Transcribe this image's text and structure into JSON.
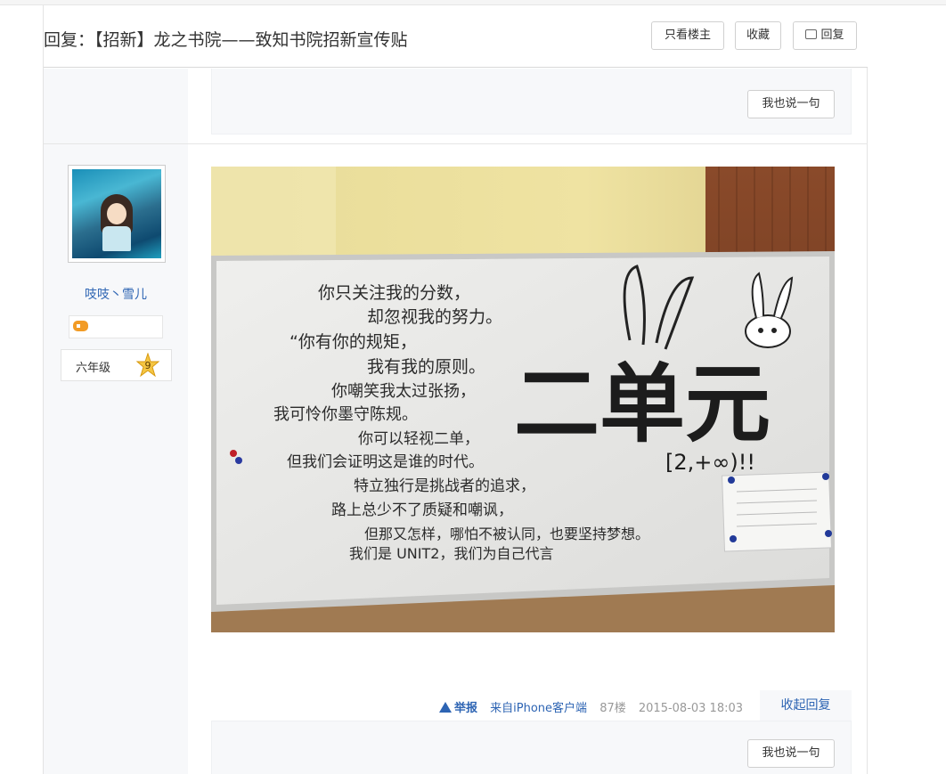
{
  "header": {
    "title": "回复：【招新】龙之书院——致知书院招新宣传贴",
    "only_op_label": "只看楼主",
    "favorite_label": "收藏",
    "reply_label": "回复"
  },
  "comment_box_top": {
    "say_label": "我也说一句"
  },
  "author": {
    "name": "吱吱丶雪儿",
    "level_name": "六年级",
    "level_num": "9",
    "avatar_icon": "anime-avatar-icon",
    "badge_icon": "gamepad-icon"
  },
  "post": {
    "image_desc_icon": "whiteboard-photo",
    "tail": {
      "report_label": "举报",
      "client": "来自iPhone客户端",
      "floor": "87楼",
      "time": "2015-08-03 18:03"
    },
    "collapse_label": "收起回复"
  },
  "whiteboard": {
    "lines": [
      "你只关注我的分数，",
      "却忽视我的努力。",
      "“你有你的规矩，",
      "我有我的原则。",
      "你嘲笑我太过张扬，",
      "我可怜你墨守陈规。",
      "你可以轻视二单，",
      "但我们会证明这是谁的时代。",
      "特立独行是挑战者的追求，",
      "路上总少不了质疑和嘲讽，",
      "但那又怎样，哪怕不被认同，也要坚持梦想。",
      "我们是 UNIT2，我们为自己代言"
    ],
    "big_title": "二单元",
    "interval": "[2,+∞)!!"
  },
  "comment_box_bottom": {
    "say_label": "我也说一句"
  }
}
